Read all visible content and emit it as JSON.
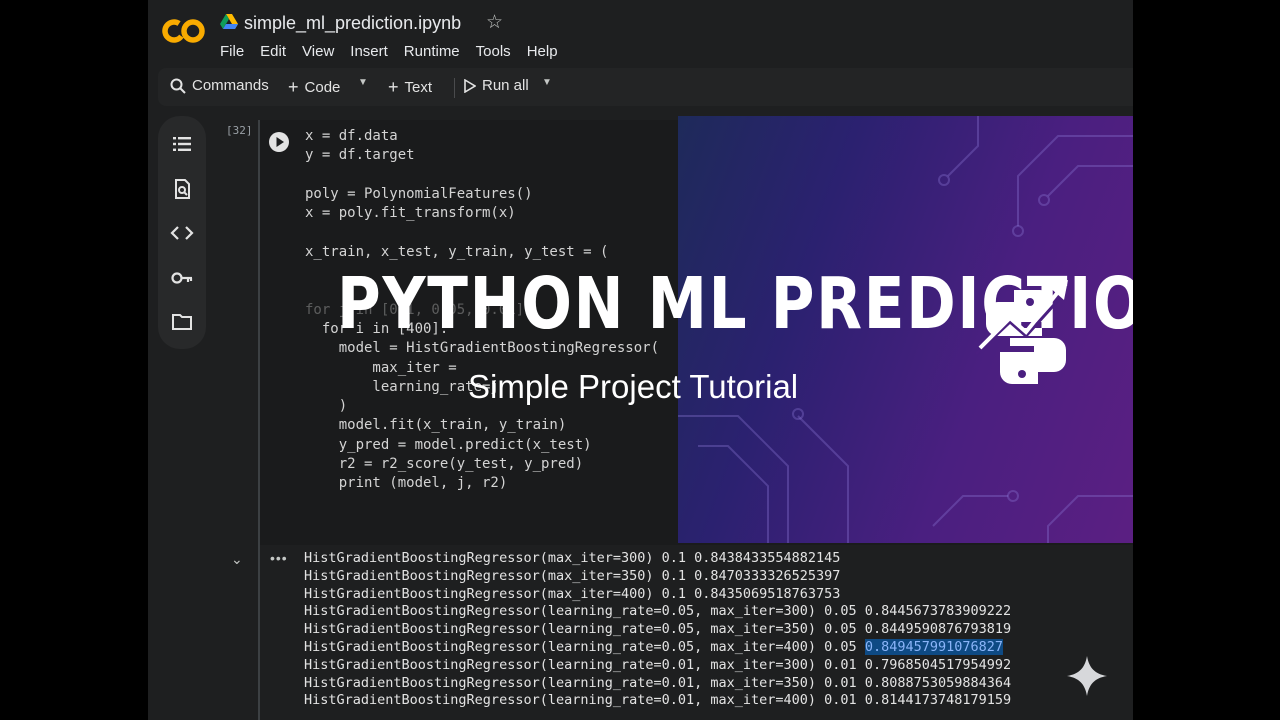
{
  "app": {
    "logo_text": "CO",
    "filename": "simple_ml_prediction.ipynb",
    "menu": [
      "File",
      "Edit",
      "View",
      "Insert",
      "Runtime",
      "Tools",
      "Help"
    ]
  },
  "toolbar": {
    "commands": "Commands",
    "code": "Code",
    "text": "Text",
    "run_all": "Run all"
  },
  "sidebar_icons": [
    "table-of-contents-icon",
    "find-replace-icon",
    "code-snippets-icon",
    "secrets-key-icon",
    "files-folder-icon"
  ],
  "cell": {
    "execution_count": "[32]",
    "code_lines": [
      "x = df.data",
      "y = df.target",
      "",
      "poly = PolynomialFeatures()",
      "x = poly.fit_transform(x)",
      "",
      "x_train, x_test, y_train, y_test = (",
      "",
      "",
      "for j in [0.1, 0.05, 0.01]:",
      "  for i in [400]:",
      "    model = HistGradientBoostingRegressor(",
      "        max_iter =",
      "        learning_rate=j",
      "    )",
      "    model.fit(x_train, y_train)",
      "    y_pred = model.predict(x_test)",
      "    r2 = r2_score(y_test, y_pred)",
      "    print (model, j, r2)"
    ]
  },
  "banner": {
    "title": "PYTHON ML PREDICTION",
    "subtitle": "Simple Project Tutorial"
  },
  "output": {
    "lines": [
      "HistGradientBoostingRegressor(max_iter=300) 0.1 0.8438433554882145",
      "HistGradientBoostingRegressor(max_iter=350) 0.1 0.8470333326525397",
      "HistGradientBoostingRegressor(max_iter=400) 0.1 0.8435069518763753",
      "HistGradientBoostingRegressor(learning_rate=0.05, max_iter=300) 0.05 0.8445673783909222",
      "HistGradientBoostingRegressor(learning_rate=0.05, max_iter=350) 0.05 0.8449590876793819",
      "HistGradientBoostingRegressor(learning_rate=0.05, max_iter=400) 0.05",
      "HistGradientBoostingRegressor(learning_rate=0.01, max_iter=300) 0.01 0.7968504517954992",
      "HistGradientBoostingRegressor(learning_rate=0.01, max_iter=350) 0.01 0.8088753059884364",
      "HistGradientBoostingRegressor(learning_rate=0.01, max_iter=400) 0.01 0.8144173748179159"
    ],
    "selected_value": "0.849457991076827"
  }
}
